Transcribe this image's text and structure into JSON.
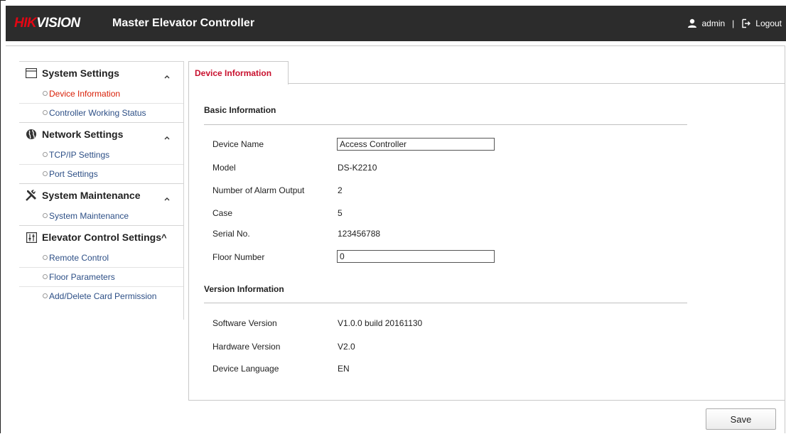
{
  "header": {
    "brand_hik": "HIK",
    "brand_vision": "VISION",
    "title": "Master Elevator Controller",
    "user": "admin",
    "separator": "|",
    "logout": "Logout"
  },
  "sidebar": {
    "groups": [
      {
        "label": "System Settings",
        "icon": "window-icon",
        "items": [
          "Device Information",
          "Controller Working Status"
        ]
      },
      {
        "label": "Network Settings",
        "icon": "globe-icon",
        "items": [
          "TCP/IP Settings",
          "Port Settings"
        ]
      },
      {
        "label": "System Maintenance",
        "icon": "tools-icon",
        "items": [
          "System Maintenance"
        ]
      },
      {
        "label": "Elevator Control Settings",
        "icon": "sliders-icon",
        "items": [
          "Remote Control",
          "Floor Parameters",
          "Add/Delete Card Permission"
        ]
      }
    ],
    "caret": "^",
    "active_item": "Device Information"
  },
  "tab": {
    "label": "Device Information"
  },
  "basic": {
    "title": "Basic Information",
    "device_name_label": "Device Name",
    "device_name_value": "Access Controller",
    "model_label": "Model",
    "model_value": "DS-K2210",
    "alarm_output_label": "Number of Alarm Output",
    "alarm_output_value": "2",
    "case_label": "Case",
    "case_value": "5",
    "serial_label": "Serial No.",
    "serial_value": "123456788",
    "floor_label": "Floor Number",
    "floor_value": "0"
  },
  "version": {
    "title": "Version Information",
    "software_label": "Software Version",
    "software_value": "V1.0.0 build 20161130",
    "hardware_label": "Hardware Version",
    "hardware_value": "V2.0",
    "language_label": "Device Language",
    "language_value": "EN"
  },
  "actions": {
    "save_label": "Save"
  },
  "colors": {
    "brand_red": "#e30613",
    "active_red": "#d81e06",
    "link_blue": "#2d4f86",
    "header_bg": "#2c2c2c"
  }
}
